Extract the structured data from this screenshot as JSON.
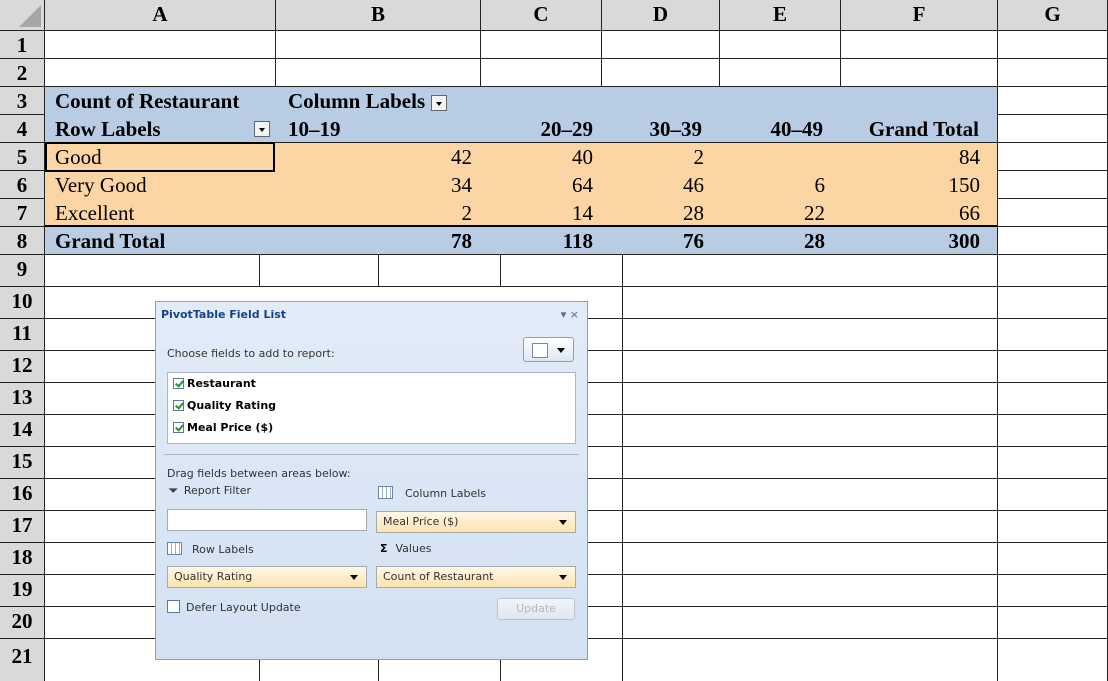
{
  "columns": [
    "A",
    "B",
    "C",
    "D",
    "E",
    "F",
    "G"
  ],
  "rows": [
    "1",
    "2",
    "3",
    "4",
    "5",
    "6",
    "7",
    "8",
    "9",
    "10",
    "11",
    "12",
    "13",
    "14",
    "15",
    "16",
    "17",
    "18",
    "19",
    "20",
    "21"
  ],
  "pivot": {
    "corner_label": "Count of Restaurant",
    "column_labels": "Column Labels",
    "row_labels": "Row Labels",
    "col_headers": [
      "10–19",
      "20–29",
      "30–39",
      "40–49",
      "Grand Total"
    ],
    "body": [
      {
        "label": "Good",
        "values": [
          "42",
          "40",
          "2",
          "",
          "84"
        ]
      },
      {
        "label": "Very Good",
        "values": [
          "34",
          "64",
          "46",
          "6",
          "150"
        ]
      },
      {
        "label": "Excellent",
        "values": [
          "2",
          "14",
          "28",
          "22",
          "66"
        ]
      }
    ],
    "grand_total": {
      "label": "Grand Total",
      "values": [
        "78",
        "118",
        "76",
        "28",
        "300"
      ]
    }
  },
  "field_list": {
    "title": "PivotTable Field List",
    "title_buttons": "▾ ×",
    "choose_label": "Choose fields to add to report:",
    "fields": [
      {
        "name": "Restaurant",
        "checked": true
      },
      {
        "name": "Quality Rating",
        "checked": true
      },
      {
        "name": "Meal Price ($)",
        "checked": true
      }
    ],
    "drag_label": "Drag fields between areas below:",
    "report_filter_label": "Report Filter",
    "column_labels_label": "Column Labels",
    "column_labels_value": "Meal Price ($)",
    "row_labels_label": "Row Labels",
    "row_labels_value": "Quality Rating",
    "values_label": "Values",
    "values_value": "Count of Restaurant",
    "defer_label": "Defer Layout Update",
    "update_label": "Update"
  },
  "colors": {
    "header_gray": "#d9d9d9",
    "pivot_blue": "#b8cce4",
    "pivot_peach": "#fcd5a4"
  }
}
